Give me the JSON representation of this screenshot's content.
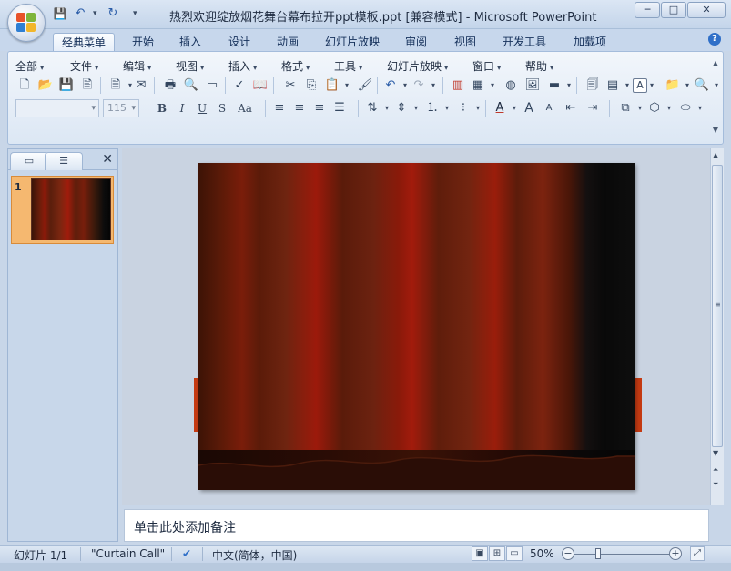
{
  "window": {
    "title": "热烈欢迎绽放烟花舞台幕布拉开ppt模板.ppt [兼容模式] - Microsoft PowerPoint",
    "minimize": "─",
    "maximize": "□",
    "close": "✕"
  },
  "qat": {
    "save": "💾",
    "undo": "↶",
    "redo": "↻",
    "customize": "▾"
  },
  "tabs": [
    "经典菜单",
    "开始",
    "插入",
    "设计",
    "动画",
    "幻灯片放映",
    "审阅",
    "视图",
    "开发工具",
    "加载项"
  ],
  "help": "?",
  "menubar": [
    "全部",
    "文件",
    "编辑",
    "视图",
    "插入",
    "格式",
    "工具",
    "幻灯片放映",
    "窗口",
    "帮助"
  ],
  "font": {
    "name": "",
    "size": "115"
  },
  "format_buttons": {
    "bold": "B",
    "italic": "I",
    "underline": "U",
    "shadow": "S",
    "case": "Aa"
  },
  "left_panel": {
    "slide_number": "1",
    "close": "✕"
  },
  "notes": {
    "placeholder": "单击此处添加备注"
  },
  "status": {
    "slide": "幻灯片 1/1",
    "theme": "\"Curtain Call\"",
    "language": "中文(简体，中国)",
    "zoom": "50%"
  }
}
